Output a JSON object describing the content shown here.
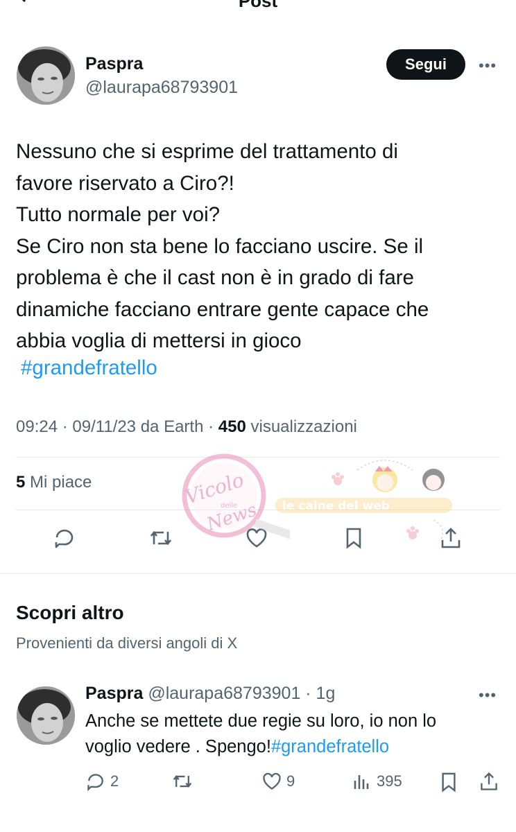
{
  "header": {
    "title": "Post"
  },
  "post": {
    "author_name": "Paspra",
    "author_handle": "@laurapa68793901",
    "follow_label": "Segui",
    "more_label": "•••",
    "text_lines": [
      "Nessuno che si esprime del trattamento di",
      "favore riservato a Ciro?!",
      "Tutto normale per voi?",
      "Se Ciro non sta bene lo facciano uscire. Se il",
      "problema è che il cast non è in grado di fare",
      "dinamiche facciano entrare gente capace che",
      "abbia voglia di mettersi in gioco"
    ],
    "hashtag": "#grandefratello",
    "time": "09:24",
    "sep1": " · ",
    "date": "09/11/23 da Earth",
    "sep2": " · ",
    "views_count": "450",
    "views_label": " visualizzazioni",
    "likes_count": "5",
    "likes_label": " Mi piace",
    "actions": [
      "reply-icon",
      "retweet-icon",
      "heart-icon",
      "bookmark-icon",
      "share-icon"
    ]
  },
  "discover": {
    "title": "Scopri altro",
    "subtitle": "Provenienti da diversi angoli di X"
  },
  "reply": {
    "author_name": "Paspra",
    "author_handle": " @laurapa68793901",
    "age": " · 1g",
    "more_label": "•••",
    "text_line1": "Anche se mettete due regie su loro, io non lo",
    "text_line2_plain": "voglio vedere . Spengo!",
    "text_line2_hashtag": "#grandefratello",
    "replies": "2",
    "likes": "9",
    "views": "395"
  },
  "watermark": {
    "logo_text_1": "Vicolo",
    "logo_text_2": "delle",
    "logo_text_3": "News",
    "banner_text": "le calne del web"
  },
  "colors": {
    "link": "#1d9bf0",
    "text": "#0f1419",
    "muted": "#536471",
    "button_bg": "#0f1419"
  }
}
